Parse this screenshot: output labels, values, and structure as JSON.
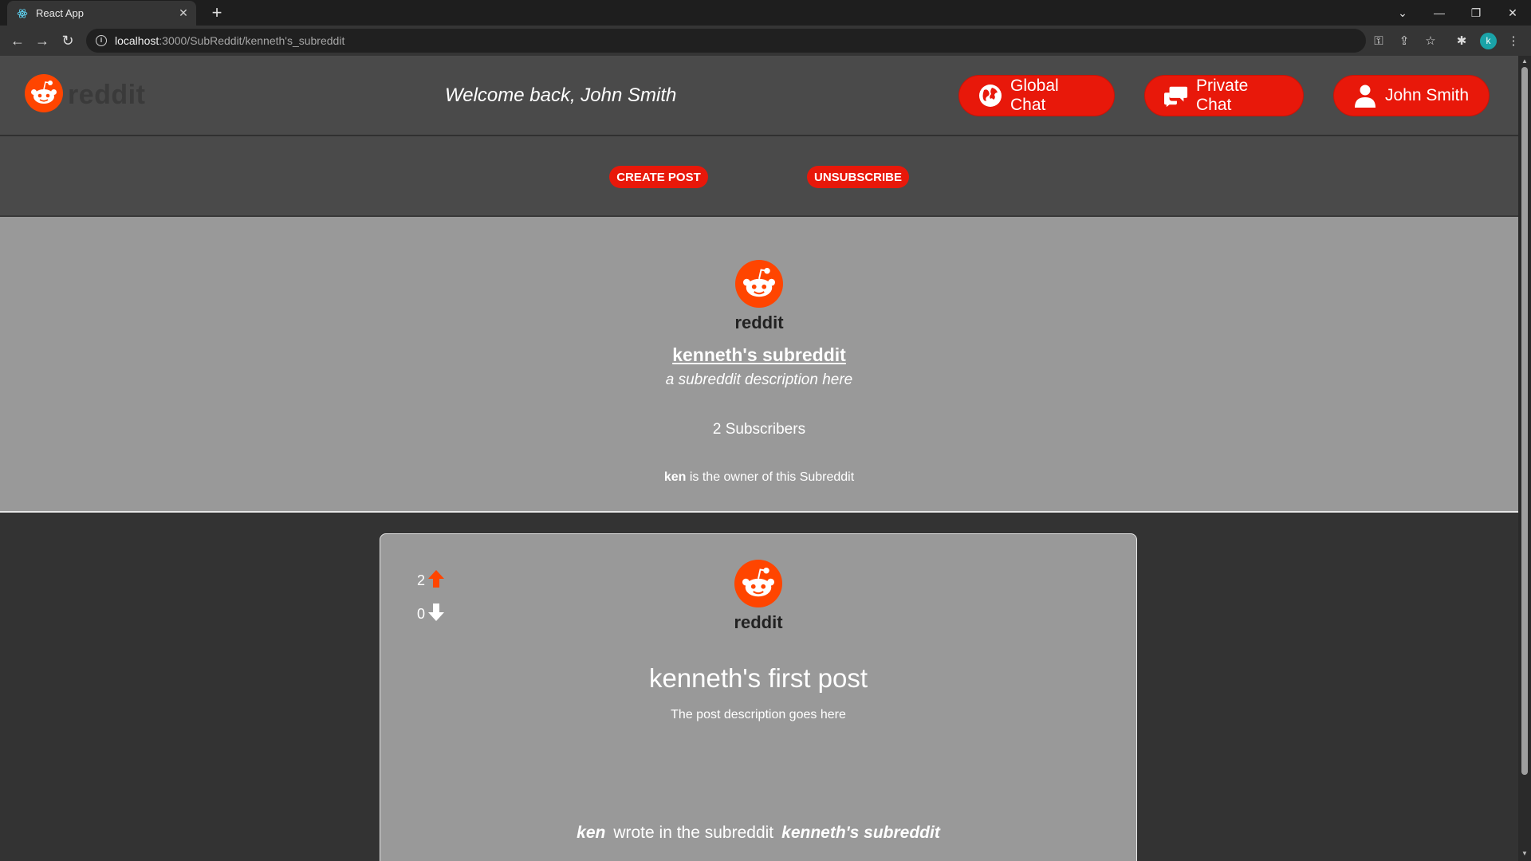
{
  "browser": {
    "tab_title": "React App",
    "tab_close": "✕",
    "new_tab": "+",
    "url_host": "localhost",
    "url_path": ":3000/SubReddit/kenneth's_subreddit",
    "profile_initial": "k"
  },
  "header": {
    "logo_text": "reddit",
    "welcome": "Welcome back, John Smith",
    "global_chat": "Global Chat",
    "private_chat": "Private Chat",
    "user": "John Smith"
  },
  "actions": {
    "create_post": "CREATE POST",
    "unsubscribe": "UNSUBSCRIBE"
  },
  "subreddit": {
    "logo_text": "reddit",
    "name": "kenneth's subreddit",
    "description": "a subreddit description here",
    "subscribers": "2 Subscribers",
    "owner": "ken",
    "owner_suffix": "is the owner of this Subreddit"
  },
  "post": {
    "upvotes": "2",
    "downvotes": "0",
    "logo_text": "reddit",
    "title": "kenneth's first post",
    "description": "The post description goes here",
    "author": "ken",
    "wrote_in": "wrote in the subreddit",
    "subreddit": "kenneth's subreddit"
  },
  "colors": {
    "accent": "#e8180a",
    "reddit_orange": "#ff4500",
    "header_bg": "#4a4a4a",
    "panel_bg": "#999999",
    "page_bg": "#333333"
  },
  "icons": [
    "react-icon",
    "globe-icon",
    "chat-bubbles-icon",
    "user-icon",
    "reddit-snoo-icon",
    "upvote-arrow-icon",
    "downvote-arrow-icon"
  ]
}
